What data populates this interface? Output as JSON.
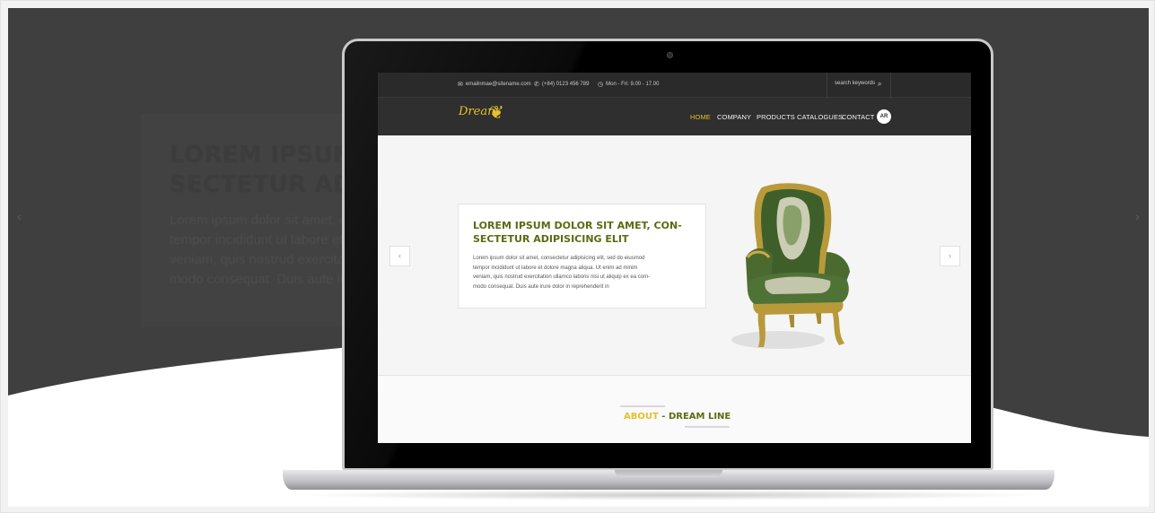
{
  "background_slide": {
    "heading": "LOREM IPSUM DOLOR SIT AMET, CON-\nSECTETUR ADIPISICING ELIT",
    "text": "Lorem ipsum dolor sit amet, consectetur\ntempor incididunt ut labore et dolore\nveniam, quis nostrud exercitation\nmodo consequat. Duis aute irure",
    "prev_arrow": "‹",
    "next_arrow": "›"
  },
  "topbar": {
    "email": "emailnmae@sitename.com",
    "phone": "(+84) 0123 456 789",
    "hours": "Mon - Fri: 9.00 - 17.00",
    "search_placeholder": "search keywords",
    "icons": [
      "mail-icon",
      "phone-icon",
      "clock-icon",
      "search-icon"
    ]
  },
  "navbar": {
    "logo_text": "Dream",
    "items": [
      "HOME",
      "COMPANY",
      "PRODUCTS",
      "CATALOGUES",
      "CONTACT"
    ],
    "active": "HOME",
    "language": "AR"
  },
  "hero": {
    "title": "LOREM IPSUM DOLOR SIT AMET, CON-\nSECTETUR ADIPISICING ELIT",
    "text": "Lorem ipsum dolor sit amet, consectetur adipisicing elit, sed do eiusmod\ntempor incididunt ut labore et dolore magna aliqua. Ut enim ad minim\nveniam, quis nostrud exercitation ullamco laboris nisi ut aliquip ex ea com-\nmodo consequat. Duis aute irure dolor in reprehenderit in",
    "prev_arrow": "‹",
    "next_arrow": "›"
  },
  "about": {
    "highlight": "ABOUT",
    "separator": " - ",
    "title": "DREAM LINE"
  },
  "colors": {
    "accent_yellow": "#e4c12a",
    "olive_heading": "#5b6b12",
    "bar_dark": "#2f2f2f",
    "bg_dark": "#3f3f3f"
  }
}
